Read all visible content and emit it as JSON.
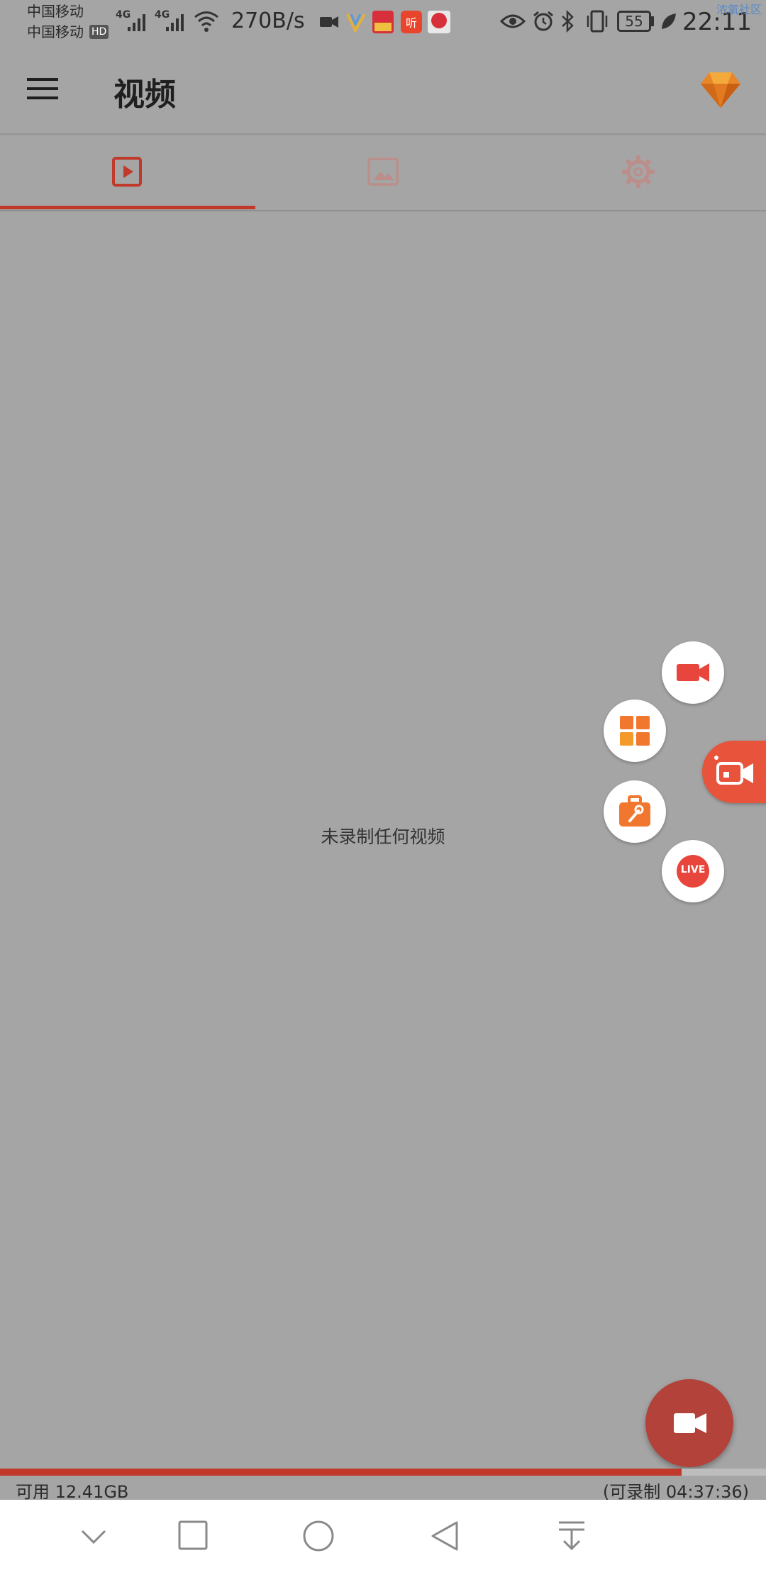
{
  "status": {
    "carrier1": "中国移动",
    "carrier2": "中国移动",
    "hd": "HD",
    "net1": "4G",
    "net2": "4G",
    "speed": "270B/s",
    "battery": "55",
    "time": "22:11",
    "watermark": "浓氧社区"
  },
  "app_bar": {
    "title": "视频"
  },
  "tabs": [
    {
      "name": "videos",
      "icon": "play-icon",
      "active": true
    },
    {
      "name": "images",
      "icon": "image-icon",
      "active": false
    },
    {
      "name": "settings",
      "icon": "gear-icon",
      "active": false
    }
  ],
  "main": {
    "empty_message": "未录制任何视频"
  },
  "floating_menu": {
    "live_label": "LIVE"
  },
  "storage": {
    "available": "可用 12.41GB",
    "recordable": "(可录制 04:37:36)",
    "used_fraction": 0.89
  },
  "colors": {
    "accent": "#c0392b",
    "orange": "#f2772e",
    "red": "#e8453c"
  }
}
